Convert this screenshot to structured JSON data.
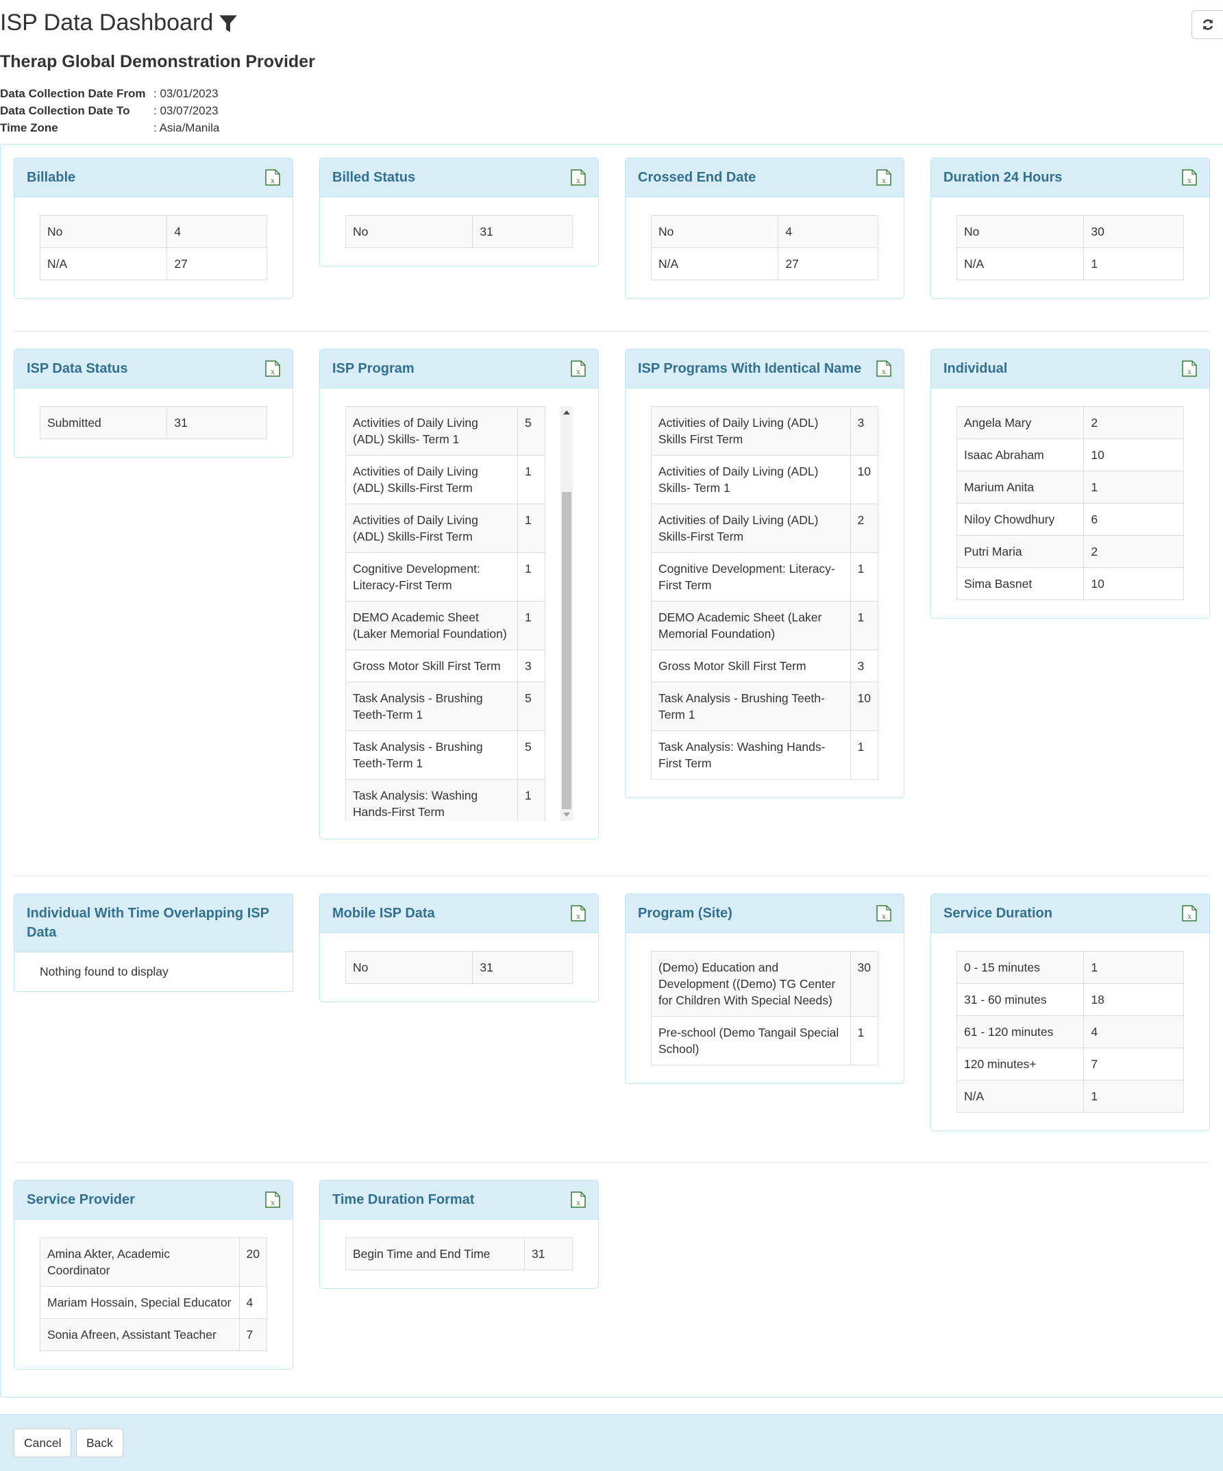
{
  "header": {
    "title": "ISP Data Dashboard",
    "provider": "Therap Global Demonstration Provider",
    "meta": [
      {
        "label": "Data Collection Date From",
        "value": ": 03/01/2023"
      },
      {
        "label": "Data Collection Date To",
        "value": ": 03/07/2023"
      },
      {
        "label": "Time Zone",
        "value": ": Asia/Manila"
      }
    ],
    "icons": {
      "filter": "funnel-icon",
      "refresh": "refresh-icon",
      "export": "excel-file-icon"
    }
  },
  "colors": {
    "panel_heading_bg": "#d9edf7",
    "panel_heading_text": "#31708f",
    "excel_icon": "#3a7a3a"
  },
  "panels": [
    {
      "title": "Billable",
      "rows": [
        [
          "No",
          "4"
        ],
        [
          "N/A",
          "27"
        ]
      ]
    },
    {
      "title": "Billed Status",
      "rows": [
        [
          "No",
          "31"
        ]
      ]
    },
    {
      "title": "Crossed End Date",
      "rows": [
        [
          "No",
          "4"
        ],
        [
          "N/A",
          "27"
        ]
      ]
    },
    {
      "title": "Duration 24 Hours",
      "rows": [
        [
          "No",
          "30"
        ],
        [
          "N/A",
          "1"
        ]
      ]
    },
    {
      "title": "ISP Data Status",
      "rows": [
        [
          "Submitted",
          "31"
        ]
      ]
    },
    {
      "title": "ISP Program",
      "scroll": true,
      "rows": [
        [
          "Activities of Daily Living (ADL) Skills- Term 1",
          "5"
        ],
        [
          "Activities of Daily Living (ADL) Skills-First Term",
          "1"
        ],
        [
          "Activities of Daily Living (ADL) Skills-First Term",
          "1"
        ],
        [
          "Cognitive Development: Literacy-First Term",
          "1"
        ],
        [
          "DEMO Academic Sheet (Laker Memorial Foundation)",
          "1"
        ],
        [
          "Gross Motor Skill First Term",
          "3"
        ],
        [
          "Task Analysis - Brushing Teeth-Term 1",
          "5"
        ],
        [
          "Task Analysis - Brushing Teeth-Term 1",
          "5"
        ],
        [
          "Task Analysis: Washing Hands-First Term",
          "1"
        ]
      ]
    },
    {
      "title": "ISP Programs With Identical Name",
      "rows": [
        [
          "Activities of Daily Living (ADL) Skills First Term",
          "3"
        ],
        [
          "Activities of Daily Living (ADL) Skills- Term 1",
          "10"
        ],
        [
          "Activities of Daily Living (ADL) Skills-First Term",
          "2"
        ],
        [
          "Cognitive Development: Literacy-First Term",
          "1"
        ],
        [
          "DEMO Academic Sheet (Laker Memorial Foundation)",
          "1"
        ],
        [
          "Gross Motor Skill First Term",
          "3"
        ],
        [
          "Task Analysis - Brushing Teeth-Term 1",
          "10"
        ],
        [
          "Task Analysis: Washing Hands-First Term",
          "1"
        ]
      ]
    },
    {
      "title": "Individual",
      "rows": [
        [
          "Angela Mary",
          "2"
        ],
        [
          "Isaac Abraham",
          "10"
        ],
        [
          "Marium Anita",
          "1"
        ],
        [
          "Niloy Chowdhury",
          "6"
        ],
        [
          "Putri Maria",
          "2"
        ],
        [
          "Sima Basnet",
          "10"
        ]
      ]
    },
    {
      "title": "Individual With Time Overlapping ISP Data",
      "empty": "Nothing found to display"
    },
    {
      "title": "Mobile ISP Data",
      "rows": [
        [
          "No",
          "31"
        ]
      ]
    },
    {
      "title": "Program (Site)",
      "rows": [
        [
          "(Demo) Education and Development ((Demo) TG Center for Children With Special Needs)",
          "30"
        ],
        [
          "Pre-school (Demo Tangail Special School)",
          "1"
        ]
      ]
    },
    {
      "title": "Service Duration",
      "rows": [
        [
          "0 - 15 minutes",
          "1"
        ],
        [
          "31 - 60 minutes",
          "18"
        ],
        [
          "61 - 120 minutes",
          "4"
        ],
        [
          "120 minutes+",
          "7"
        ],
        [
          "N/A",
          "1"
        ]
      ]
    },
    {
      "title": "Service Provider",
      "rows": [
        [
          "Amina Akter, Academic Coordinator",
          "20"
        ],
        [
          "Mariam Hossain, Special Educator",
          "4"
        ],
        [
          "Sonia Afreen, Assistant Teacher",
          "7"
        ]
      ]
    },
    {
      "title": "Time Duration Format",
      "rows": [
        [
          "Begin Time and End Time",
          "31"
        ]
      ]
    }
  ],
  "footer": {
    "cancel": "Cancel",
    "back": "Back"
  }
}
